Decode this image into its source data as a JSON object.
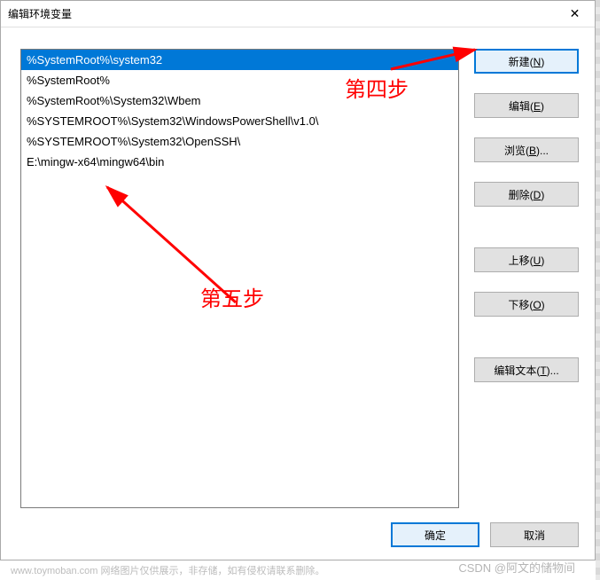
{
  "window": {
    "title": "编辑环境变量",
    "close": "✕"
  },
  "paths": [
    "%SystemRoot%\\system32",
    "%SystemRoot%",
    "%SystemRoot%\\System32\\Wbem",
    "%SYSTEMROOT%\\System32\\WindowsPowerShell\\v1.0\\",
    "%SYSTEMROOT%\\System32\\OpenSSH\\",
    "E:\\mingw-x64\\mingw64\\bin"
  ],
  "selected_index": 0,
  "buttons": {
    "new": "新建(N)",
    "edit": "编辑(E)",
    "browse": "浏览(B)...",
    "delete": "删除(D)",
    "move_up": "上移(U)",
    "move_down": "下移(O)",
    "edit_text": "编辑文本(T)...",
    "ok": "确定",
    "cancel": "取消"
  },
  "annotations": {
    "step4": "第四步",
    "step5": "第五步"
  },
  "footer": {
    "left": "www.toymoban.com 网络图片仅供展示，非存储，如有侵权请联系删除。",
    "right": "CSDN @阿文的储物间"
  }
}
